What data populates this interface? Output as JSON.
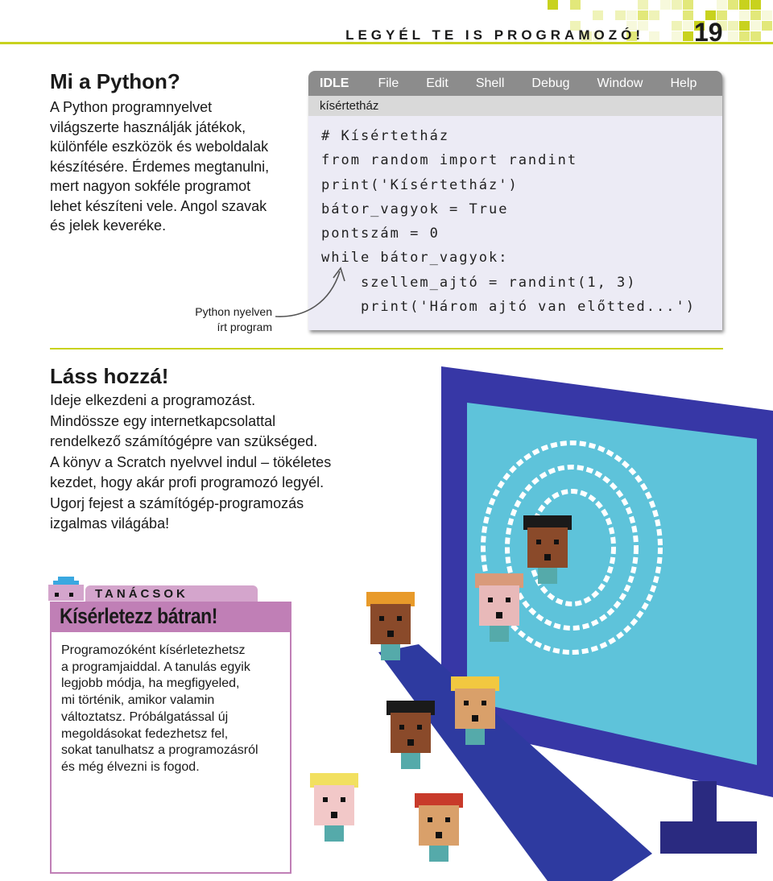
{
  "header": {
    "title": "LEGYÉL TE IS PROGRAMOZÓ!",
    "page_number": "19",
    "accent_color": "#c8d21e"
  },
  "intro": {
    "title": "Mi a Python?",
    "lines": [
      "A Python programnyelvet",
      "világszerte használják játékok,",
      "különféle eszközök és weboldalak",
      "készítésére. Érdemes megtanulni,",
      "mert nagyon sokféle programot",
      "lehet készíteni vele. Angol szavak",
      "és jelek keveréke."
    ]
  },
  "idle": {
    "menu": [
      "IDLE",
      "File",
      "Edit",
      "Shell",
      "Debug",
      "Window",
      "Help"
    ],
    "tab": "kísértetház",
    "code": [
      "# Kísértetház",
      "from random import randint",
      "print('Kísértetház')",
      "bátor_vagyok = True",
      "pontszám = 0",
      "while bátor_vagyok:",
      "    szellem_ajtó = randint(1, 3)",
      "    print('Három ajtó van előtted...')"
    ]
  },
  "caption": {
    "lines": [
      "Python nyelven",
      "írt program"
    ]
  },
  "start": {
    "title": "Láss hozzá!",
    "lines": [
      "Ideje elkezdeni a programozást.",
      "Mindössze egy internetkapcsolattal",
      "rendelkező számítógépre van szükséged.",
      "A könyv a Scratch nyelvvel indul – tökéletes",
      "kezdet, hogy akár profi programozó legyél.",
      "Ugorj fejest a számítógép-programozás",
      "izgalmas világába!"
    ]
  },
  "tips": {
    "label": "TANÁCSOK",
    "title": "Kísérletezz bátran!",
    "accent_color": "#c07fb6",
    "lines": [
      "Programozóként kísérletezhetsz",
      "a programjaiddal. A tanulás egyik",
      "legjobb módja, ha megfigyeled,",
      "mi történik, amikor valamin",
      "változtatsz. Próbálgatással új",
      "megoldásokat fedezhetsz fel,",
      "sokat tanulhatsz a programozásról",
      "és még élvezni is fogod."
    ]
  }
}
